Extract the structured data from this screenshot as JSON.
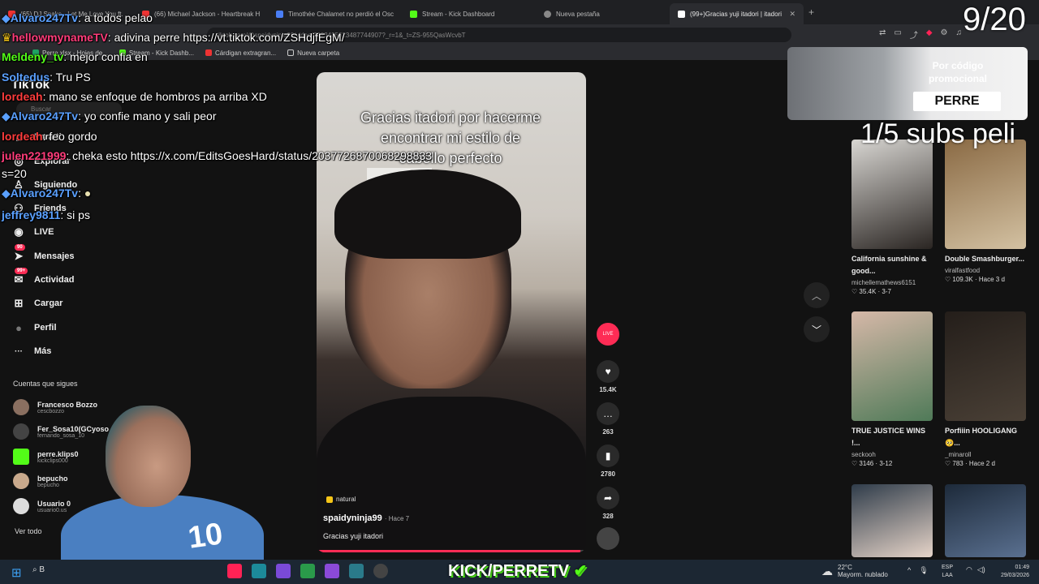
{
  "browser": {
    "tabs": [
      {
        "label": "(65) DJ Snake - Let Me Love You ft.",
        "color": "#e33"
      },
      {
        "label": "(66) Michael Jackson - Heartbreak H",
        "color": "#e33"
      },
      {
        "label": "Timothée Chalamet no perdió el Osc",
        "color": "#4a7ef5"
      },
      {
        "label": "Stream - Kick Dashboard",
        "color": "#53fc18"
      },
      {
        "label": "Nueva pestaña",
        "color": "#888"
      },
      {
        "label": "(99+)Gracias yuji itadori | itadori",
        "color": "#fff"
      }
    ],
    "url": "tiktok.com/@spaidyninja99/video/7523435623487744907?_r=1&_t=ZS-955QasWcvbT",
    "bookmarks": [
      "Perre.xlsx - Hojas de...",
      "Stream - Kick Dashb...",
      "Cárdigan extragran...",
      "Nueva carpeta"
    ]
  },
  "sidebar": {
    "logo": "TikTok",
    "search_placeholder": "Buscar",
    "nav": [
      {
        "label": "Para ti",
        "icon": "home-icon",
        "glyph": "⌂"
      },
      {
        "label": "Explorar",
        "icon": "compass-icon",
        "glyph": "◎"
      },
      {
        "label": "Siguiendo",
        "icon": "following-icon",
        "glyph": "♙"
      },
      {
        "label": "Friends",
        "icon": "friends-icon",
        "glyph": "⚇"
      },
      {
        "label": "LIVE",
        "icon": "live-icon",
        "glyph": "◉"
      },
      {
        "label": "Mensajes",
        "icon": "messages-icon",
        "glyph": "➤",
        "badge": "90"
      },
      {
        "label": "Actividad",
        "icon": "activity-icon",
        "glyph": "✉",
        "badge": "99+"
      },
      {
        "label": "Cargar",
        "icon": "upload-icon",
        "glyph": "⊞"
      },
      {
        "label": "Perfil",
        "icon": "profile-icon",
        "glyph": "●"
      },
      {
        "label": "Más",
        "icon": "more-icon",
        "glyph": "···"
      }
    ],
    "following_header": "Cuentas que sigues",
    "accounts": [
      {
        "name": "Francesco Bozzo",
        "user": "cescbozzo"
      },
      {
        "name": "Fer_Sosa10(GCyoso",
        "user": "fernando_sosa_10"
      },
      {
        "name": "perre.klips0",
        "user": "kickclips000"
      },
      {
        "name": "bepucho",
        "user": "bepucho"
      },
      {
        "name": "Usuario 0",
        "user": "usuario0.us"
      }
    ],
    "see_all": "Ver todo"
  },
  "video": {
    "caption": "Gracias itadori por hacerme encontrar mi estilo de cabello perfecto",
    "tag": "natural",
    "author": "spaidyninja99",
    "time": "· Hace 7",
    "description": "Gracias yuji itadori",
    "progress": 0.98
  },
  "actions": [
    {
      "name": "like",
      "glyph": "♥",
      "count": "15.4K"
    },
    {
      "name": "comment",
      "glyph": "…",
      "count": "263"
    },
    {
      "name": "save",
      "glyph": "▮",
      "count": "2780"
    },
    {
      "name": "share",
      "glyph": "➦",
      "count": "328"
    }
  ],
  "live_badge": "LIVE",
  "promo": {
    "text": "Por código promocional",
    "code": "PERRE"
  },
  "overlay": {
    "counter": "9/20",
    "subs": "1/5 subs peli"
  },
  "cards": [
    {
      "title": "California sunshine & good...",
      "user": "michellemathews6151",
      "likes": "35.4K",
      "when": "3-7",
      "colors": [
        "#d8d6d2",
        "#2a2522"
      ]
    },
    {
      "title": "Double Smashburger...",
      "user": "viralfastfood",
      "likes": "109.3K",
      "when": "Hace 3 d",
      "colors": [
        "#8a6a44",
        "#d3c1a2"
      ]
    },
    {
      "title": "TRUE JUSTICE WINS !...",
      "user": "seckooh",
      "likes": "3146",
      "when": "3-12",
      "colors": [
        "#d6b8a8",
        "#4f7a58"
      ]
    },
    {
      "title": "Porfiiin HOOLIGANG 🥺...",
      "user": "_minaroll",
      "likes": "783",
      "when": "Hace 2 d",
      "colors": [
        "#241e1a",
        "#4a4036"
      ]
    },
    {
      "title": "",
      "user": "",
      "likes": "",
      "when": "",
      "colors": [
        "#2f3c4a",
        "#e6d4c8"
      ]
    },
    {
      "title": "",
      "user": "",
      "likes": "",
      "when": "",
      "colors": [
        "#1d2a3a",
        "#5a7090"
      ]
    }
  ],
  "chat": [
    {
      "user": "Alvaro247Tv",
      "text": ": a todos pelao",
      "color": "#5aa0ff"
    },
    {
      "user": "hellowmynameTV",
      "text": ": adivina perre https://vt.tiktok.com/ZSHdjfEgM/",
      "color": "#ff3c7a"
    },
    {
      "user": "Meldeny_tv",
      "text": ": mejor confia en",
      "color": "#53fc18"
    },
    {
      "user": "Soltedus",
      "text": ": Tru PS",
      "color": "#5aa0ff"
    },
    {
      "user": "lordeah",
      "text": ": mano se enfoque de hombros pa arriba XD",
      "color": "#ff3c3c"
    },
    {
      "user": "Alvaro247Tv",
      "text": ": yo confie mano y sali peor",
      "color": "#5aa0ff"
    },
    {
      "user": "lordeah",
      "text": ": feo gordo",
      "color": "#ff3c3c"
    },
    {
      "user": "julen221999",
      "text": ": cheka esto https://x.com/EditsGoesHard/status/2037726870068298833",
      "color": "#ff3c7a"
    },
    {
      "user": "",
      "text": "s=20",
      "color": "#fff"
    },
    {
      "user": "Alvaro247Tv",
      "text": ":",
      "color": "#5aa0ff"
    },
    {
      "user": "jeffrey9811",
      "text": ": si ps",
      "color": "#5aa0ff"
    }
  ],
  "stream": {
    "brand": "KICK/PERRETV",
    "jersey": "10"
  },
  "taskbar": {
    "search": "B",
    "temp": "22°C",
    "weather": "Mayorm. nublado",
    "lang1": "ESP",
    "lang2": "LAA",
    "time": "01:49",
    "date": "29/03/2026"
  }
}
